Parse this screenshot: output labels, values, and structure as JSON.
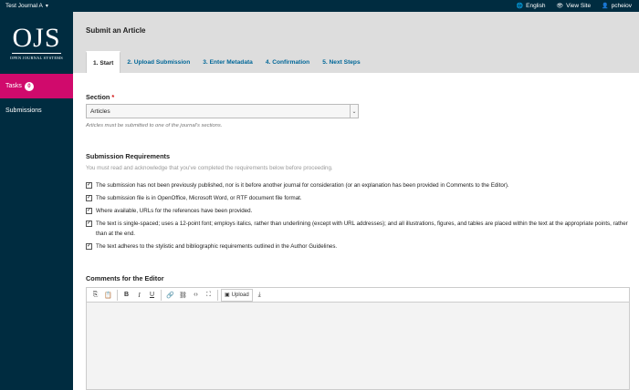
{
  "topbar": {
    "journal_name": "Test Journal A",
    "language": "English",
    "view_site": "View Site",
    "username": "pcheiov"
  },
  "sidebar": {
    "logo_text": "OJS",
    "logo_subtitle": "OPEN JOURNAL SYSTEMS",
    "tasks_label": "Tasks",
    "tasks_count": "0",
    "submissions_label": "Submissions"
  },
  "header": {
    "title": "Submit an Article",
    "tabs": [
      {
        "label": "1. Start"
      },
      {
        "label": "2. Upload Submission"
      },
      {
        "label": "3. Enter Metadata"
      },
      {
        "label": "4. Confirmation"
      },
      {
        "label": "5. Next Steps"
      }
    ]
  },
  "form": {
    "section_label": "Section",
    "required_mark": "*",
    "section_value": "Articles",
    "section_help": "Articles must be submitted to one of the journal's sections.",
    "requirements_label": "Submission Requirements",
    "requirements_desc": "You must read and acknowledge that you've completed the requirements below before proceeding.",
    "requirements": [
      "The submission has not been previously published, nor is it before another journal for consideration (or an explanation has been provided in Comments to the Editor).",
      "The submission file is in OpenOffice, Microsoft Word, or RTF document file format.",
      "Where available, URLs for the references have been provided.",
      "The text is single-spaced; uses a 12-point font; employs italics, rather than underlining (except with URL addresses); and all illustrations, figures, and tables are placed within the text at the appropriate points, rather than at the end.",
      "The text adheres to the stylistic and bibliographic requirements outlined in the Author Guidelines."
    ],
    "comments_label": "Comments for the Editor",
    "toolbar": {
      "bold": "B",
      "italic": "I",
      "underline": "U",
      "upload_label": "Upload"
    }
  },
  "colors": {
    "navy": "#002c40",
    "accent": "#d00a6c",
    "link": "#006798"
  }
}
